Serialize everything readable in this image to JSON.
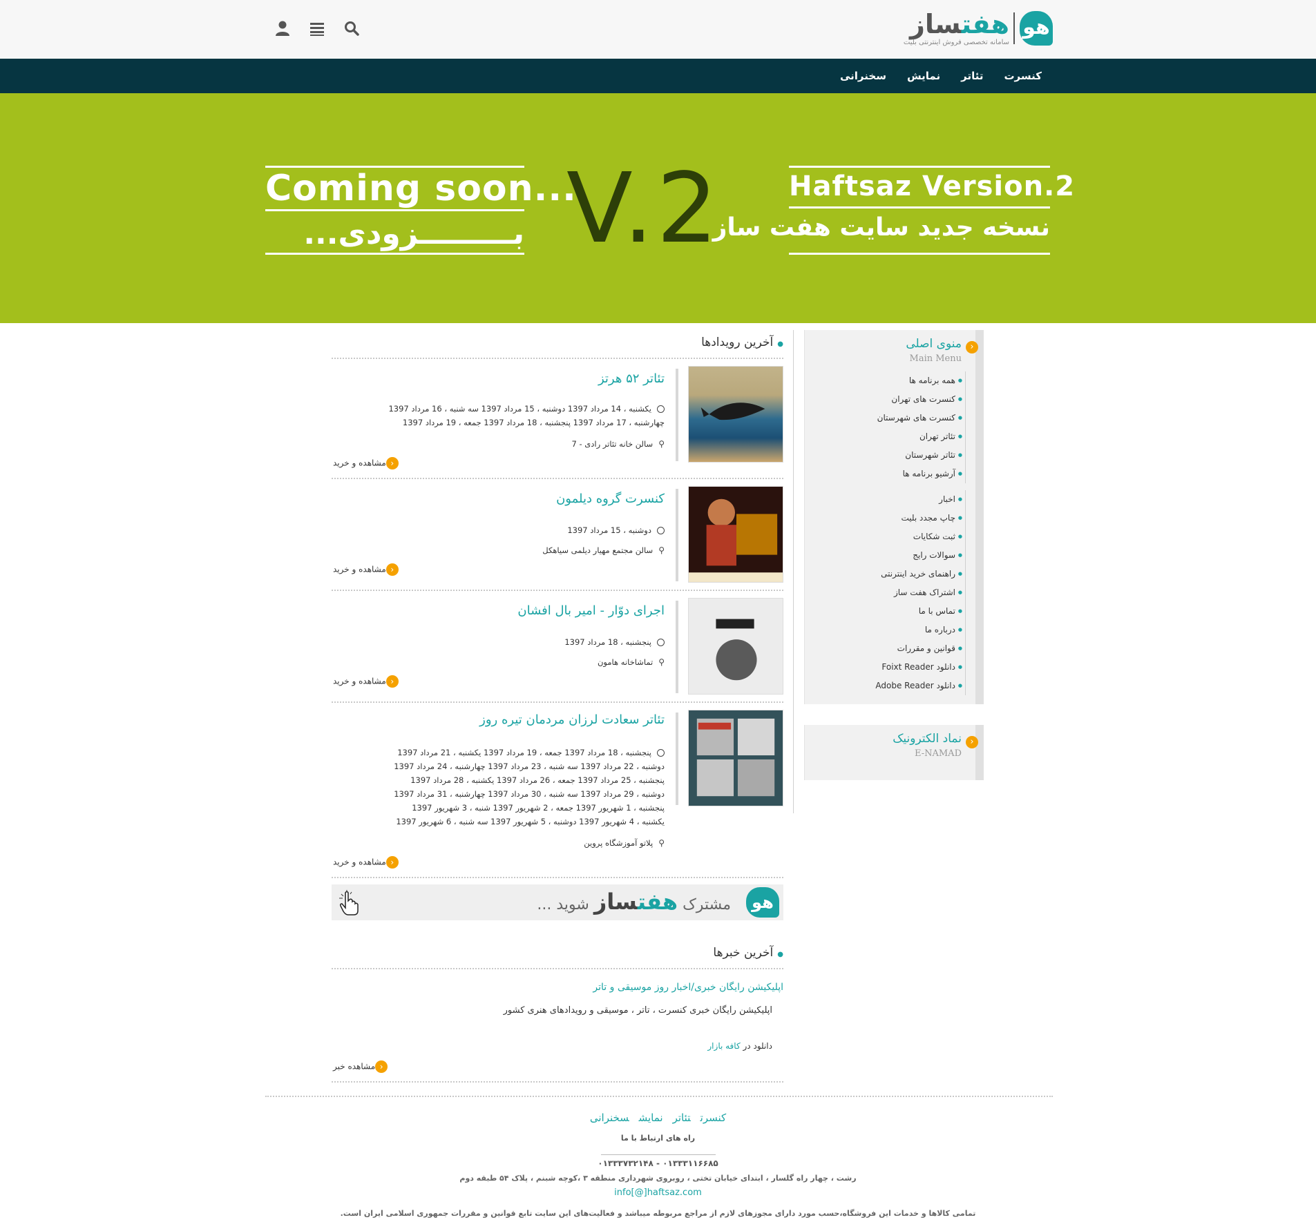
{
  "header": {
    "logo_name_a": "هفت",
    "logo_name_b": "ساز",
    "logo_tagline": "سامانه تخصصی فروش اینترنتی بلیت",
    "icons": [
      "user-icon",
      "menu-icon",
      "search-icon"
    ]
  },
  "nav": {
    "items": [
      "کنسرت",
      "تئاتر",
      "نمایش",
      "سخنرانی"
    ]
  },
  "banner": {
    "coming_soon": "Coming soon...",
    "coming_soon_fa": "بـــــــــزودی...",
    "version": "V.2",
    "version_en": "Haftsaz Version.2",
    "version_fa": "نسخه جدید سایت هفت ساز"
  },
  "sidebar": {
    "main_menu": {
      "title": "منوی اصلی",
      "subtitle": "Main Menu",
      "group1": [
        "همه برنامه ها",
        "کنسرت های تهران",
        "کنسرت های شهرستان",
        "تئاتر تهران",
        "تئاتر شهرستان",
        "آرشیو برنامه ها"
      ],
      "group2": [
        "اخبار",
        "چاپ مجدد بلیت",
        "ثبت شکایات",
        "سوالات رایج",
        "راهنمای خرید اینترنتی",
        "اشتراک هفت ساز",
        "تماس با ما",
        "درباره ما",
        "قوانین و مقررات",
        "دانلود Foixt Reader",
        "دانلود Adobe Reader"
      ]
    },
    "enamad": {
      "title": "نماد الکترونیک",
      "subtitle": "E-NAMAD"
    }
  },
  "events": {
    "section_title": "آخرین رویدادها",
    "more_label": "مشاهده و خرید",
    "items": [
      {
        "title": "تئاتر ۵۲ هرتز",
        "dates": [
          "یکشنبه ، 14 مرداد 1397      دوشنبه ، 15 مرداد 1397      سه شنبه ، 16 مرداد 1397",
          "چهارشنبه ، 17 مرداد 1397      پنجشنبه ، 18 مرداد 1397      جمعه ، 19 مرداد 1397"
        ],
        "venue": "سالن خانه تئاتر رادی - 7"
      },
      {
        "title": "کنسرت گروه دیلمون",
        "dates": [
          "دوشنبه ، 15 مرداد 1397"
        ],
        "venue": "سالن مجتمع مهیار دیلمی سیاهکل"
      },
      {
        "title": "اجرای دوّار - امیر بال افشان",
        "dates": [
          "پنجشنبه ، 18 مرداد 1397"
        ],
        "venue": "تماشاخانه هامون"
      },
      {
        "title": "تئاتر سعادت لرزان مردمان تیره روز",
        "dates": [
          "پنجشنبه ، 18 مرداد 1397      جمعه ، 19 مرداد 1397      یکشنبه ، 21 مرداد 1397",
          "دوشنبه ، 22 مرداد 1397      سه شنبه ، 23 مرداد 1397      چهارشنبه ، 24 مرداد 1397",
          "پنجشنبه ، 25 مرداد 1397      جمعه ، 26 مرداد 1397      یکشنبه ، 28 مرداد 1397",
          "دوشنبه ، 29 مرداد 1397      سه شنبه ، 30 مرداد 1397      چهارشنبه ، 31 مرداد 1397",
          "پنجشنبه ، 1 شهریور 1397      جمعه ، 2 شهریور 1397      شنبه ، 3 شهریور 1397",
          "یکشنبه ، 4 شهریور 1397      دوشنبه ، 5 شهریور 1397      سه شنبه ، 6 شهریور 1397"
        ],
        "venue": "پلاتو آموزشگاه پروین"
      }
    ]
  },
  "promo": {
    "text_before": "مشترک",
    "brand_a": "هفت",
    "brand_b": "ساز",
    "text_after": "شوید ..."
  },
  "news": {
    "section_title": "آخرین خبرها",
    "title": "اپلیکیشن رایگان خبری/اخبار روز موسیقی و تاتر",
    "body": "اپلیکیشن رایگان خبری کنسرت ، تاتر ، موسیقی و رویدادهای هنری کشور",
    "download_prefix": "دانلود در",
    "download_link": "کافه بازار",
    "more_label": "مشاهده خبر"
  },
  "footer": {
    "links": [
      "کنسرت",
      "تئاتر",
      "نمایش",
      "سخنرانی"
    ],
    "contact_title": "راه های ارتباط با ما",
    "phones": "۰۱۳۳۳۱۱۶۶۸۵ - ۰۱۳۳۳۷۳۲۱۴۸",
    "address": "رشت ، چهار راه گلسار ، ابتدای خیابان تختی ، روبروی شهرداری منطقه ۳ ،کوچه شبنم ، پلاک ۵۴ طبقه دوم",
    "email": "info[@]haftsaz.com",
    "legal": "تمامی کالاها و خدمات این فروشگاه،حسب مورد دارای مجوزهای لازم از مراجع مربوطه میباشد و فعالیت‌های این سایت تابع قوانین و مقررات جمهوری اسلامی ایران است."
  }
}
